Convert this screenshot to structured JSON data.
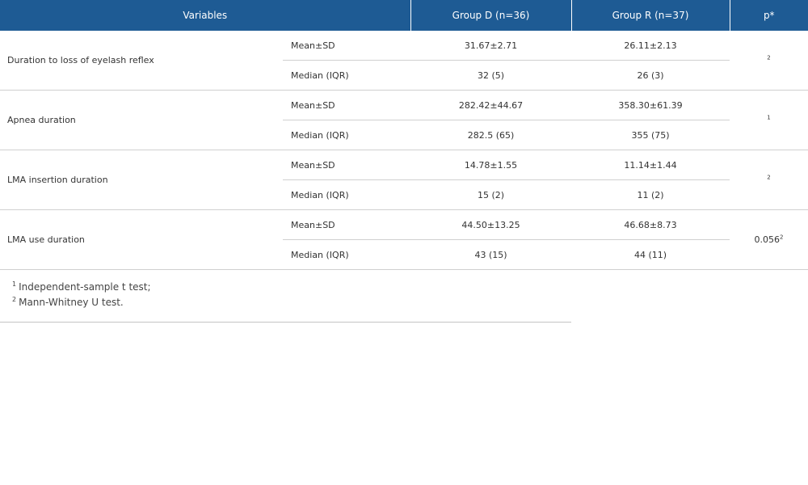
{
  "headers": {
    "variables": "Variables",
    "group_d": "Group D (n=36)",
    "group_r": "Group R (n=37)",
    "p": "p*"
  },
  "rows": [
    {
      "variable": "Duration to loss of eyelash reflex",
      "mean_label": "Mean±SD",
      "mean_d": "31.67±2.71",
      "mean_r": "26.11±2.13",
      "median_label": "Median (IQR)",
      "median_d": "32 (5)",
      "median_r": "26 (3)",
      "p_value": "",
      "p_sup": "2"
    },
    {
      "variable": "Apnea duration",
      "mean_label": "Mean±SD",
      "mean_d": "282.42±44.67",
      "mean_r": "358.30±61.39",
      "median_label": "Median (IQR)",
      "median_d": "282.5 (65)",
      "median_r": "355 (75)",
      "p_value": "",
      "p_sup": "1"
    },
    {
      "variable": "LMA insertion duration",
      "mean_label": "Mean±SD",
      "mean_d": "14.78±1.55",
      "mean_r": "11.14±1.44",
      "median_label": "Median (IQR)",
      "median_d": "15 (2)",
      "median_r": "11 (2)",
      "p_value": "",
      "p_sup": "2"
    },
    {
      "variable": "LMA use duration",
      "mean_label": "Mean±SD",
      "mean_d": "44.50±13.25",
      "mean_r": "46.68±8.73",
      "median_label": "Median (IQR)",
      "median_d": "43 (15)",
      "median_r": "44 (11)",
      "p_value": "0.056",
      "p_sup": "2"
    }
  ],
  "footnotes": [
    {
      "sup": "1",
      "text": "Independent-sample t test;"
    },
    {
      "sup": "2",
      "text": "Mann-Whitney U test."
    }
  ]
}
